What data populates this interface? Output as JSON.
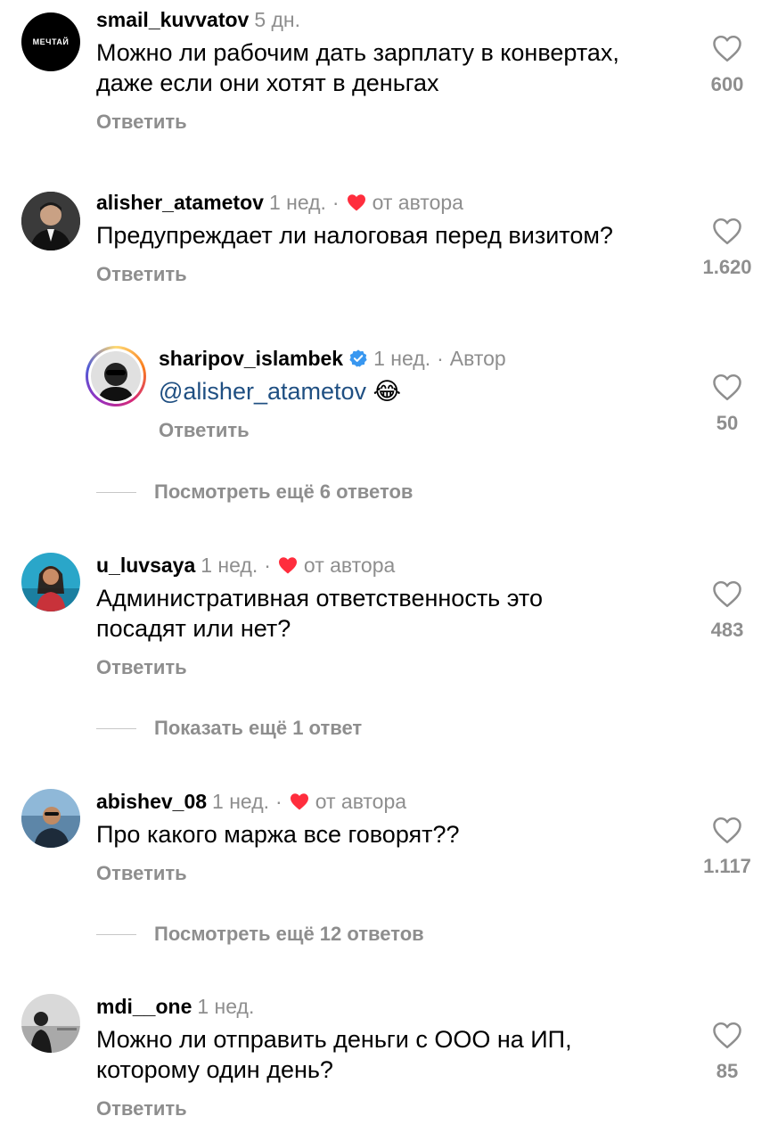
{
  "reply_label": "Ответить",
  "comments": [
    {
      "username": "smail_kuvvatov",
      "time": "5 дн.",
      "text_line1": "Можно ли рабочим дать зарплату в конвертах,",
      "text_line2": "даже если они хотят в деньгах",
      "likes": "600",
      "avatar_text": "МЕЧТАЙ"
    },
    {
      "username": "alisher_atametov",
      "time": "1 нед.",
      "author_label": "от автора",
      "text_line1": "Предупреждает ли налоговая перед визитом?",
      "likes": "1.620"
    },
    {
      "username": "sharipov_islambek",
      "time": "1 нед.",
      "author_label": "Автор",
      "mention": "@alisher_atametov",
      "emoji": "😂",
      "likes": "50"
    },
    {
      "username": "u_luvsaya",
      "time": "1 нед.",
      "author_label": "от автора",
      "text_line1": "Административная ответственность это",
      "text_line2": "посадят или нет?",
      "likes": "483"
    },
    {
      "username": "abishev_08",
      "time": "1 нед.",
      "author_label": "от автора",
      "text_line1": "Про какого маржа все говорят??",
      "likes": "1.117"
    },
    {
      "username": "mdi__one",
      "time": "1 нед.",
      "text_line1": "Можно ли отправить деньги с ООО на ИП,",
      "text_line2": "которому один день?",
      "likes": "85"
    }
  ],
  "more_replies": [
    "Посмотреть ещё 6 ответов",
    "Показать ещё 1 ответ",
    "Посмотреть ещё 12 ответов"
  ],
  "colors": {
    "heart_red": "#ff2d3d",
    "verified_blue": "#3897f0",
    "mention_blue": "#1f4f82",
    "muted_gray": "#8e8e8e"
  }
}
